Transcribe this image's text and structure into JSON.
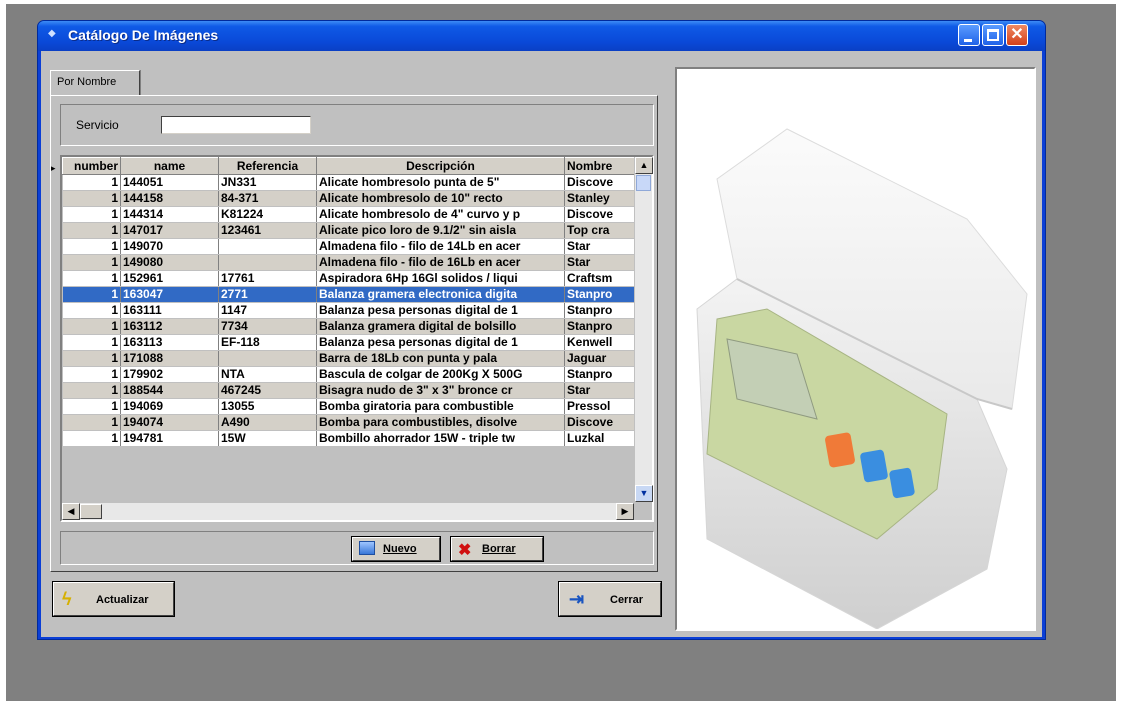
{
  "window": {
    "title": "Catálogo De Imágenes",
    "title_icon": "app-icon",
    "controls": {
      "minimize_icon": "minimize-icon",
      "maximize_icon": "maximize-icon",
      "close_icon": "close-icon"
    }
  },
  "tabs": [
    {
      "label": "Por Nombre",
      "active": true
    }
  ],
  "filter": {
    "label": "Servicio",
    "value": ""
  },
  "grid": {
    "columns": [
      "number",
      "name",
      "Referencia",
      "Descripción",
      "Nombre"
    ],
    "selected_index": 7,
    "rows": [
      [
        "1",
        "144051",
        "JN331",
        "Alicate hombresolo punta de 5\"",
        "Discove"
      ],
      [
        "1",
        "144158",
        "84-371",
        "Alicate hombresolo de 10\" recto",
        "Stanley"
      ],
      [
        "1",
        "144314",
        "K81224",
        "Alicate hombresolo de 4\"  curvo y p",
        "Discove"
      ],
      [
        "1",
        "147017",
        "123461",
        "Alicate pico loro de 9.1/2\" sin aisla",
        "Top cra"
      ],
      [
        "1",
        "149070",
        "",
        "Almadena filo - filo de 14Lb en acer",
        "Star"
      ],
      [
        "1",
        "149080",
        "",
        "Almadena filo - filo de 16Lb en acer",
        "Star"
      ],
      [
        "1",
        "152961",
        "17761",
        "Aspiradora 6Hp 16Gl solidos / liqui",
        "Craftsm"
      ],
      [
        "1",
        "163047",
        "2771",
        "Balanza gramera electronica digita",
        "Stanpro"
      ],
      [
        "1",
        "163111",
        "1147",
        "Balanza pesa personas digital de 1",
        "Stanpro"
      ],
      [
        "1",
        "163112",
        "7734",
        "Balanza gramera digital de bolsillo",
        "Stanpro"
      ],
      [
        "1",
        "163113",
        "EF-118",
        "Balanza pesa personas digital de 1",
        "Kenwell"
      ],
      [
        "1",
        "171088",
        "",
        "Barra de 18Lb con punta y pala",
        "Jaguar"
      ],
      [
        "1",
        "179902",
        "NTA",
        "Bascula de colgar de 200Kg X 500G",
        "Stanpro"
      ],
      [
        "1",
        "188544",
        "467245",
        "Bisagra nudo de 3\" x 3\"  bronce cr",
        "Star"
      ],
      [
        "1",
        "194069",
        "13055",
        "Bomba giratoria para combustible",
        "Pressol"
      ],
      [
        "1",
        "194074",
        "A490",
        "Bomba para combustibles, disolve",
        "Discove"
      ],
      [
        "1",
        "194781",
        "15W",
        "Bombillo ahorrador 15W - triple tw",
        "Luzkal"
      ]
    ]
  },
  "buttons": {
    "nuevo": {
      "label": "Nuevo",
      "icon": "new-record-icon"
    },
    "borrar": {
      "label": "Borrar",
      "icon": "delete-icon"
    },
    "actualizar": {
      "label": "Actualizar",
      "icon": "lightning-icon"
    },
    "cerrar": {
      "label": "Cerrar",
      "icon": "exit-door-icon"
    }
  },
  "preview": {
    "subject": "digital kitchen scale product photo"
  },
  "colors": {
    "titlebar": "#0a49d8",
    "selection": "#316ac5",
    "face": "#c0c0c0"
  }
}
